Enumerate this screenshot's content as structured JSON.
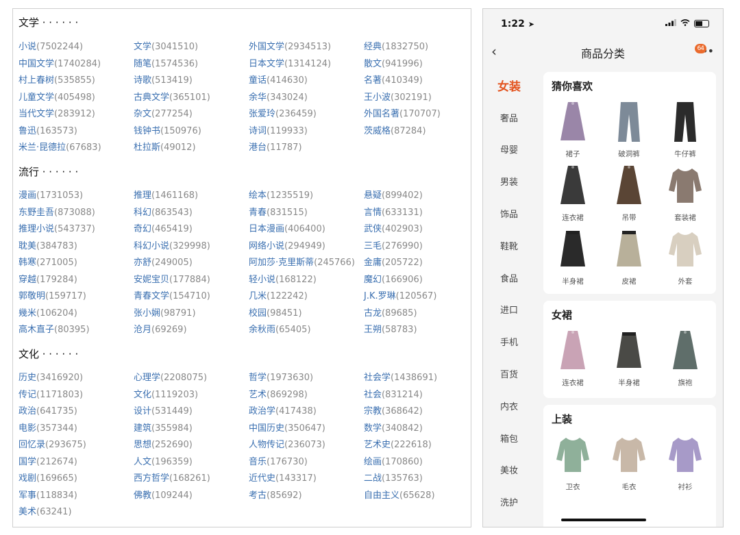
{
  "sections": [
    {
      "title": "文学 · · · · · ·",
      "tags": [
        {
          "name": "小说",
          "count": "(7502244)"
        },
        {
          "name": "文学",
          "count": "(3041510)"
        },
        {
          "name": "外国文学",
          "count": "(2934513)"
        },
        {
          "name": "经典",
          "count": "(1832750)"
        },
        {
          "name": "中国文学",
          "count": "(1740284)"
        },
        {
          "name": "随笔",
          "count": "(1574536)"
        },
        {
          "name": "日本文学",
          "count": "(1314124)"
        },
        {
          "name": "散文",
          "count": "(941996)"
        },
        {
          "name": "村上春树",
          "count": "(535855)"
        },
        {
          "name": "诗歌",
          "count": "(513419)"
        },
        {
          "name": "童话",
          "count": "(414630)"
        },
        {
          "name": "名著",
          "count": "(410349)"
        },
        {
          "name": "儿童文学",
          "count": "(405498)"
        },
        {
          "name": "古典文学",
          "count": "(365101)"
        },
        {
          "name": "余华",
          "count": "(343024)"
        },
        {
          "name": "王小波",
          "count": "(302191)"
        },
        {
          "name": "当代文学",
          "count": "(283912)"
        },
        {
          "name": "杂文",
          "count": "(277254)"
        },
        {
          "name": "张爱玲",
          "count": "(236459)"
        },
        {
          "name": "外国名著",
          "count": "(170707)"
        },
        {
          "name": "鲁迅",
          "count": "(163573)"
        },
        {
          "name": "钱钟书",
          "count": "(150976)"
        },
        {
          "name": "诗词",
          "count": "(119933)"
        },
        {
          "name": "茨威格",
          "count": "(87284)"
        },
        {
          "name": "米兰·昆德拉",
          "count": "(67683)"
        },
        {
          "name": "杜拉斯",
          "count": "(49012)"
        },
        {
          "name": "港台",
          "count": "(11787)"
        }
      ]
    },
    {
      "title": "流行 · · · · · ·",
      "tags": [
        {
          "name": "漫画",
          "count": "(1731053)"
        },
        {
          "name": "推理",
          "count": "(1461168)"
        },
        {
          "name": "绘本",
          "count": "(1235519)"
        },
        {
          "name": "悬疑",
          "count": "(899402)"
        },
        {
          "name": "东野圭吾",
          "count": "(873088)"
        },
        {
          "name": "科幻",
          "count": "(863543)"
        },
        {
          "name": "青春",
          "count": "(831515)"
        },
        {
          "name": "言情",
          "count": "(633131)"
        },
        {
          "name": "推理小说",
          "count": "(543737)"
        },
        {
          "name": "奇幻",
          "count": "(465419)"
        },
        {
          "name": "日本漫画",
          "count": "(406400)"
        },
        {
          "name": "武侠",
          "count": "(402903)"
        },
        {
          "name": "耽美",
          "count": "(384783)"
        },
        {
          "name": "科幻小说",
          "count": "(329998)"
        },
        {
          "name": "网络小说",
          "count": "(294949)"
        },
        {
          "name": "三毛",
          "count": "(276990)"
        },
        {
          "name": "韩寒",
          "count": "(271005)"
        },
        {
          "name": "亦舒",
          "count": "(249005)"
        },
        {
          "name": "阿加莎·克里斯蒂",
          "count": "(245766)"
        },
        {
          "name": "金庸",
          "count": "(205722)"
        },
        {
          "name": "穿越",
          "count": "(179284)"
        },
        {
          "name": "安妮宝贝",
          "count": "(177884)"
        },
        {
          "name": "轻小说",
          "count": "(168122)"
        },
        {
          "name": "魔幻",
          "count": "(166906)"
        },
        {
          "name": "郭敬明",
          "count": "(159717)"
        },
        {
          "name": "青春文学",
          "count": "(154710)"
        },
        {
          "name": "几米",
          "count": "(122242)"
        },
        {
          "name": "J.K.罗琳",
          "count": "(120567)"
        },
        {
          "name": "幾米",
          "count": "(106204)"
        },
        {
          "name": "张小娴",
          "count": "(98791)"
        },
        {
          "name": "校园",
          "count": "(98451)"
        },
        {
          "name": "古龙",
          "count": "(89685)"
        },
        {
          "name": "高木直子",
          "count": "(80395)"
        },
        {
          "name": "沧月",
          "count": "(69269)"
        },
        {
          "name": "余秋雨",
          "count": "(65405)"
        },
        {
          "name": "王朔",
          "count": "(58783)"
        }
      ]
    },
    {
      "title": "文化 · · · · · ·",
      "tags": [
        {
          "name": "历史",
          "count": "(3416920)"
        },
        {
          "name": "心理学",
          "count": "(2208075)"
        },
        {
          "name": "哲学",
          "count": "(1973630)"
        },
        {
          "name": "社会学",
          "count": "(1438691)"
        },
        {
          "name": "传记",
          "count": "(1171803)"
        },
        {
          "name": "文化",
          "count": "(1119203)"
        },
        {
          "name": "艺术",
          "count": "(869298)"
        },
        {
          "name": "社会",
          "count": "(831214)"
        },
        {
          "name": "政治",
          "count": "(641735)"
        },
        {
          "name": "设计",
          "count": "(531449)"
        },
        {
          "name": "政治学",
          "count": "(417438)"
        },
        {
          "name": "宗教",
          "count": "(368642)"
        },
        {
          "name": "电影",
          "count": "(357344)"
        },
        {
          "name": "建筑",
          "count": "(355984)"
        },
        {
          "name": "中国历史",
          "count": "(350647)"
        },
        {
          "name": "数学",
          "count": "(340842)"
        },
        {
          "name": "回忆录",
          "count": "(293675)"
        },
        {
          "name": "思想",
          "count": "(252690)"
        },
        {
          "name": "人物传记",
          "count": "(236073)"
        },
        {
          "name": "艺术史",
          "count": "(222618)"
        },
        {
          "name": "国学",
          "count": "(212674)"
        },
        {
          "name": "人文",
          "count": "(196359)"
        },
        {
          "name": "音乐",
          "count": "(176730)"
        },
        {
          "name": "绘画",
          "count": "(170860)"
        },
        {
          "name": "戏剧",
          "count": "(169665)"
        },
        {
          "name": "西方哲学",
          "count": "(168261)"
        },
        {
          "name": "近代史",
          "count": "(143317)"
        },
        {
          "name": "二战",
          "count": "(135763)"
        },
        {
          "name": "军事",
          "count": "(118834)"
        },
        {
          "name": "佛教",
          "count": "(109244)"
        },
        {
          "name": "考古",
          "count": "(85692)"
        },
        {
          "name": "自由主义",
          "count": "(65628)"
        },
        {
          "name": "美术",
          "count": "(63241)"
        }
      ]
    }
  ],
  "phone": {
    "status": {
      "time": "1:22",
      "location_icon": "location-arrow-icon"
    },
    "nav": {
      "back": "‹",
      "title": "商品分类",
      "badge": "64"
    },
    "categories": [
      "女装",
      "奢品",
      "母婴",
      "男装",
      "饰品",
      "鞋靴",
      "食品",
      "进口",
      "手机",
      "百货",
      "内衣",
      "箱包",
      "美妆",
      "洗护"
    ],
    "active_category": "女装",
    "accent_color": "#e3531e",
    "cards": [
      {
        "title": "猜你喜欢",
        "items": [
          "裙子",
          "破洞裤",
          "牛仔裤",
          "连衣裙",
          "吊带",
          "套装裙",
          "半身裙",
          "皮裙",
          "外套"
        ]
      },
      {
        "title": "女裙",
        "items": [
          "连衣裙",
          "半身裙",
          "旗袍"
        ]
      },
      {
        "title": "上装",
        "items": [
          "卫衣",
          "毛衣",
          "衬衫"
        ]
      }
    ]
  }
}
